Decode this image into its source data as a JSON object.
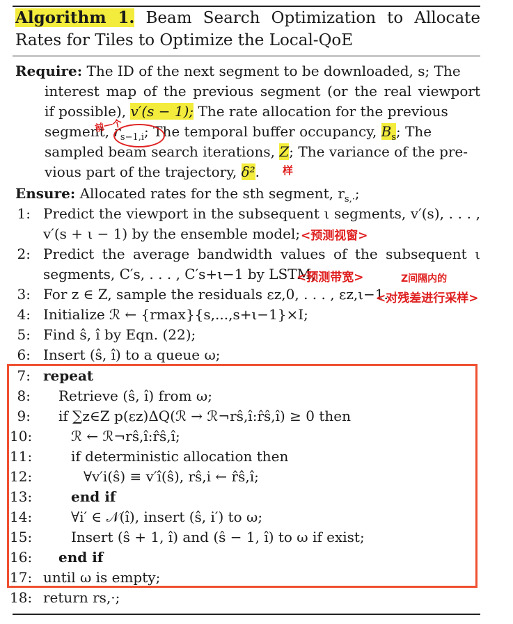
{
  "title": {
    "label": "Algorithm 1.",
    "text": "Beam Search Optimization to Allocate Rates for Tiles to Optimize the Local-QoE"
  },
  "require": {
    "keyword": "Require:",
    "l1": "The ID of the next segment to be downloaded, s; The",
    "l2": "interest map of the previous segment (or the real viewport",
    "l3a": "if possible),",
    "l3b": "v′(s − 1);",
    "l3c": "The rate allocation for the previous",
    "l4a": "segment,",
    "l4b": "r",
    "l4b_sub": "s−1,i",
    "l4c": "; The temporal buffer occupancy,",
    "l4d": "B",
    "l4d_sub": "s",
    "l4e": "; The",
    "l5a": "sampled beam search iterations,",
    "l5b": "Z",
    "l5c": "; The variance of the pre-",
    "l6a": "vious part of the trajectory,",
    "l6b": "δ²",
    "l6c": "."
  },
  "ensure": {
    "keyword": "Ensure:",
    "text": "Allocated rates for the sth segment, r",
    "sub": "s,·",
    "end": ";"
  },
  "steps": [
    {
      "n": "1:",
      "text": "Predict the viewport in the subsequent ι segments, v′(s), . . . ,"
    },
    {
      "n": "",
      "text": "v′(s + ι − 1) by the ensemble model;"
    },
    {
      "n": "2:",
      "text": "Predict the average bandwidth values of the subsequent ι"
    },
    {
      "n": "",
      "text": "segments, C′s, . . . , C′s+ι−1 by LSTM;"
    },
    {
      "n": "3:",
      "text": "For z ∈ Z, sample the residuals εz,0, . . . , εz,ι−1."
    },
    {
      "n": "4:",
      "text": "Initialize ℛ ← {rmax}{s,...,s+ι−1}×I;"
    },
    {
      "n": "5:",
      "text": "Find ŝ, î by Eqn. (22);"
    },
    {
      "n": "6:",
      "text": "Insert (ŝ, î) to a queue ω;"
    },
    {
      "n": "7:",
      "text": "repeat"
    },
    {
      "n": "8:",
      "text": "Retrieve (ŝ, î) from ω;"
    },
    {
      "n": "9:",
      "text": "if ∑z∈Z p(εz)ΔQ(ℛ → ℛ¬rŝ,î:r̂ŝ,î) ≥ 0 then"
    },
    {
      "n": "10:",
      "text": "ℛ ← ℛ¬rŝ,î:r̂ŝ,î;"
    },
    {
      "n": "11:",
      "text": "if deterministic allocation then"
    },
    {
      "n": "12:",
      "text": "∀v′i(ŝ) ≡ v′î(ŝ), rŝ,i ← r̂ŝ,î;"
    },
    {
      "n": "13:",
      "text": "end if"
    },
    {
      "n": "14:",
      "text": "∀i′ ∈ 𝒩(î), insert (ŝ, i′) to ω;"
    },
    {
      "n": "15:",
      "text": "Insert (ŝ + 1, î) and (ŝ − 1, î) to ω if exist;"
    },
    {
      "n": "16:",
      "text": "end if"
    },
    {
      "n": "17:",
      "text": "until ω is empty;"
    },
    {
      "n": "18:",
      "text": "return rs,·;"
    }
  ],
  "annotations": {
    "prev_tile": "前一个",
    "sample_note": "样",
    "predict_viewport": "<预测视窗>",
    "predict_bandwidth": "<预测带宽>",
    "sample_residual": "<对残差进行采样>",
    "interval_note": "Z间隔内的"
  },
  "colors": {
    "highlight": "#f3ec3c",
    "annotation": "#e02020",
    "box": "#ef5030"
  }
}
